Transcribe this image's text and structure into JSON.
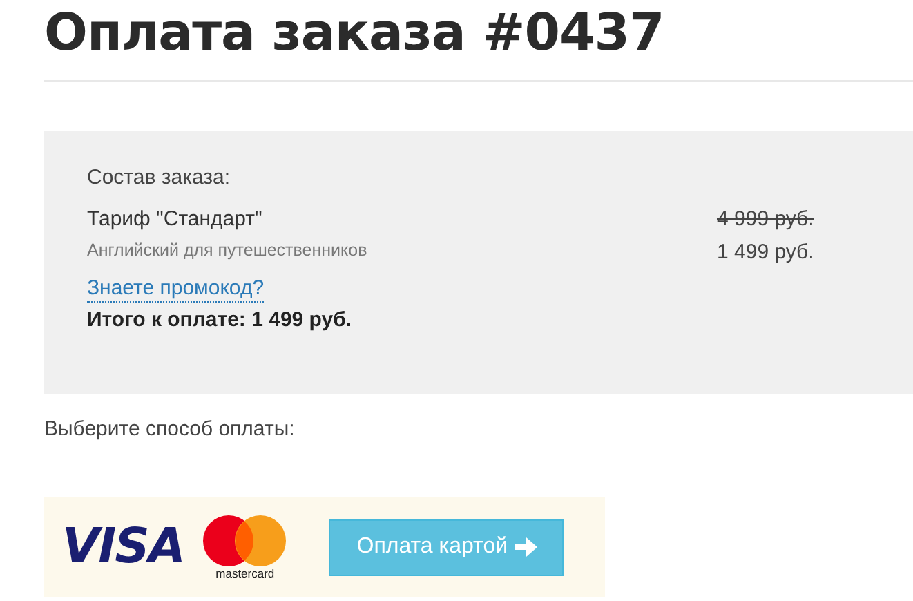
{
  "title": "Оплата заказа #0437",
  "order": {
    "heading": "Состав заказа:",
    "item": {
      "name": "Тариф \"Стандарт\"",
      "description": "Английский для путешественников",
      "old_price": "4 999 руб.",
      "price": "1 499 руб."
    },
    "promo_link": "Знаете промокод?",
    "total": "Итого к оплате: 1 499 руб."
  },
  "payment": {
    "prompt": "Выберите способ оплаты:",
    "logos": [
      {
        "kind": "visa",
        "text": "VISA"
      },
      {
        "kind": "mastercard",
        "text": "mastercard"
      }
    ],
    "button": "Оплата картой"
  }
}
